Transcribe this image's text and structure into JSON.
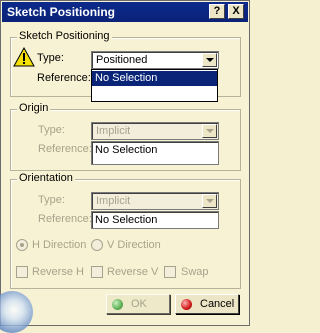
{
  "window": {
    "title": "Sketch Positioning",
    "help_label": "?",
    "close_label": "X"
  },
  "sketch_positioning": {
    "legend": "Sketch Positioning",
    "type_label": "Type:",
    "type_value": "Positioned",
    "reference_label": "Reference:",
    "dropdown_items": [
      "No Selection"
    ]
  },
  "origin": {
    "legend": "Origin",
    "type_label": "Type:",
    "type_value": "Implicit",
    "reference_label": "Reference:",
    "reference_value": "No Selection"
  },
  "orientation": {
    "legend": "Orientation",
    "type_label": "Type:",
    "type_value": "Implicit",
    "reference_label": "Reference:",
    "reference_value": "No Selection"
  },
  "options": {
    "h_direction": "H Direction",
    "v_direction": "V Direction",
    "reverse_h": "Reverse H",
    "reverse_v": "Reverse V",
    "swap": "Swap"
  },
  "buttons": {
    "ok": "OK",
    "cancel": "Cancel"
  },
  "colors": {
    "titlebar": "#0a2278",
    "background": "#f7f2d3",
    "ok_dot": "#2a9a2a",
    "cancel_dot": "#d01818"
  }
}
